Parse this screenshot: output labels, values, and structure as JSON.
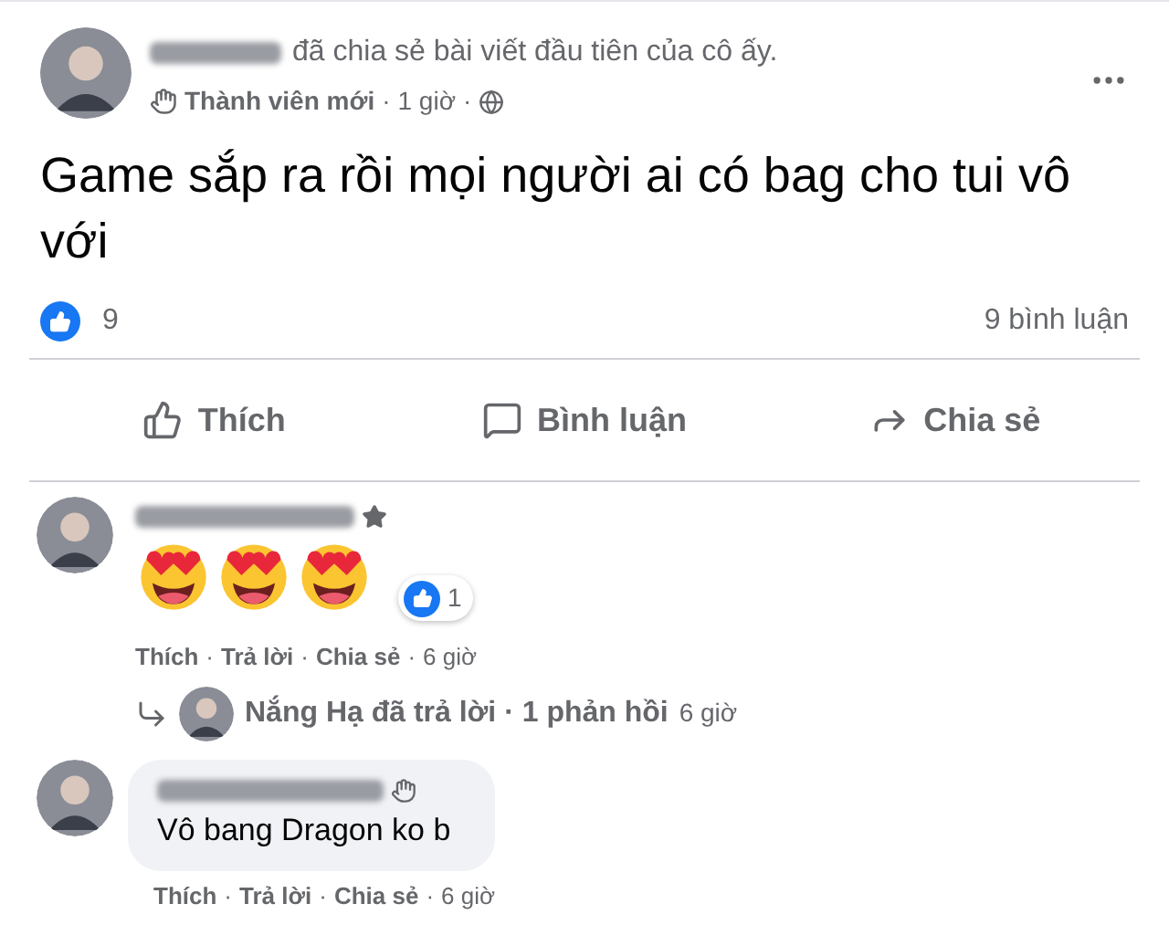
{
  "separator": "·",
  "post": {
    "header_text": "đã chia sẻ bài viết đầu tiên của cô ấy.",
    "badge": "Thành viên mới",
    "time": "1 giờ",
    "body": "Game sắp ra rồi mọi người ai có bag cho tui vô với",
    "reaction_count": "9",
    "comment_count": "9 bình luận"
  },
  "actions": [
    {
      "label": "Thích",
      "kind": "like"
    },
    {
      "label": "Bình luận",
      "kind": "comment"
    },
    {
      "label": "Chia sẻ",
      "kind": "share"
    }
  ],
  "comments": [
    {
      "kind": "emoji",
      "emojis": [
        {
          "kind": "heart_eyes"
        },
        {
          "kind": "heart_eyes"
        },
        {
          "kind": "heart_eyes"
        }
      ],
      "name_badge": {
        "kind": "star"
      },
      "reaction_count": "1",
      "links": [
        "Thích",
        "Trả lời",
        "Chia sẻ"
      ],
      "time": "6 giờ",
      "reply_summary": {
        "text": "Nắng Hạ đã trả lời · 1 phản hồi",
        "time": "6 giờ"
      }
    },
    {
      "kind": "text",
      "text": "Vô bang Dragon ko b",
      "name_badge": {
        "kind": "wave"
      },
      "links": [
        "Thích",
        "Trả lời",
        "Chia sẻ"
      ],
      "time": "6 giờ"
    }
  ]
}
